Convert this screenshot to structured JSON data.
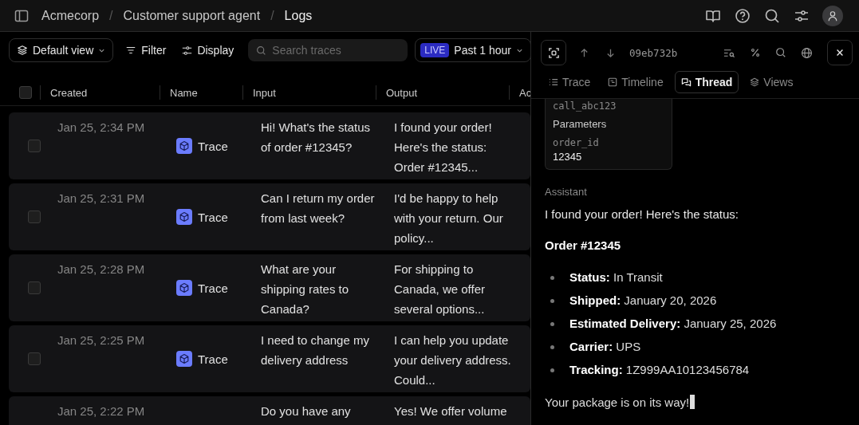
{
  "breadcrumbs": [
    "Acmecorp",
    "Customer support agent",
    "Logs"
  ],
  "breadcrumb_separator": "/",
  "toolbar": {
    "view": "Default view",
    "filter": "Filter",
    "display": "Display",
    "search": {
      "placeholder": "Search traces"
    },
    "live_badge": "LIVE",
    "time_range": "Past 1 hour"
  },
  "table": {
    "header_checked": false,
    "columns": [
      "Created",
      "Name",
      "Input",
      "Output",
      "Ac"
    ],
    "rows": [
      {
        "checked": false,
        "created": "Jan 25, 2:34 PM",
        "name": "Trace",
        "input": "Hi! What's the status of order #12345?",
        "output": "I found your order! Here's the status: Order #12345..."
      },
      {
        "checked": false,
        "created": "Jan 25, 2:31 PM",
        "name": "Trace",
        "input": "Can I return my order from last week?",
        "output": "I'd be happy to help with your return. Our policy..."
      },
      {
        "checked": false,
        "created": "Jan 25, 2:28 PM",
        "name": "Trace",
        "input": "What are your shipping rates to Canada?",
        "output": "For shipping to Canada, we offer several options..."
      },
      {
        "checked": false,
        "created": "Jan 25, 2:25 PM",
        "name": "Trace",
        "input": "I need to change my delivery address",
        "output": "I can help you update your delivery address. Could..."
      },
      {
        "created": "Jan 25, 2:22 PM",
        "input": "Do you have any",
        "output": "Yes! We offer volume"
      }
    ]
  },
  "detail": {
    "trace_id": "09eb732b",
    "tabs": [
      {
        "label": "Trace",
        "selected": false
      },
      {
        "label": "Timeline",
        "selected": false
      },
      {
        "label": "Thread",
        "selected": true
      },
      {
        "label": "Views",
        "selected": false
      }
    ],
    "tool_card": {
      "call_id": "call_abc123",
      "section": "Parameters",
      "param_name": "order_id",
      "param_value": "12345"
    },
    "role": "Assistant",
    "intro": "I found your order! Here's the status:",
    "heading": "Order #12345",
    "items": [
      "**Status:** In Transit",
      "**Shipped:** January 20, 2026",
      "**Estimated Delivery:** January 25, 2026",
      "**Carrier:** UPS",
      "**Tracking:** 1Z999AA10123456784"
    ],
    "closing": "Your package is on its way!"
  }
}
